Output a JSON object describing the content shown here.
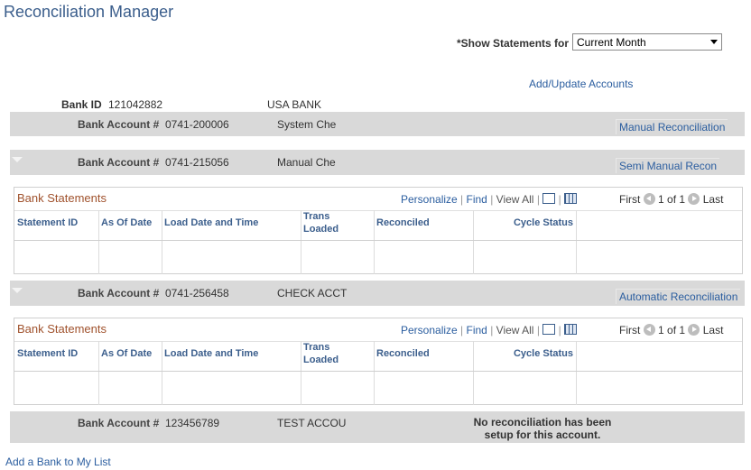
{
  "page": {
    "title": "Reconciliation Manager",
    "show_statements_label": "*Show Statements for",
    "show_statements_value": "Current Month",
    "add_update_accounts": "Add/Update Accounts",
    "add_bank_link": "Add a Bank to My List"
  },
  "bank": {
    "id_label": "Bank ID",
    "id_value": "121042882",
    "name": "USA BANK"
  },
  "accounts": [
    {
      "label": "Bank Account #",
      "number": "0741-200006",
      "desc": "System Che",
      "recon_link": "Manual Reconciliation"
    },
    {
      "label": "Bank Account #",
      "number": "0741-215056",
      "desc": "Manual Che",
      "recon_link": "Semi Manual Recon"
    },
    {
      "label": "Bank Account #",
      "number": "0741-256458",
      "desc": "CHECK ACCT",
      "recon_link": "Automatic Reconciliation"
    },
    {
      "label": "Bank Account #",
      "number": "123456789",
      "desc": "TEST ACCOU",
      "note": "No reconciliation has been setup for this account."
    }
  ],
  "grid": {
    "title": "Bank Statements",
    "personalize": "Personalize",
    "find": "Find",
    "view_all": "View All",
    "separator": "|",
    "first": "First",
    "range": "1 of 1",
    "last": "Last",
    "columns": {
      "statement_id": "Statement ID",
      "as_of_date": "As Of Date",
      "load_date_time": "Load Date and Time",
      "trans_loaded_1": "Trans",
      "trans_loaded_2": "Loaded",
      "reconciled": "Reconciled",
      "cycle_status": "Cycle Status"
    }
  },
  "icons": {
    "collapse": "collapse-triangle-icon",
    "zoom": "zoom-grid-icon",
    "download": "download-excel-icon",
    "prev": "previous-row-icon",
    "next": "next-row-icon"
  },
  "colors": {
    "link": "#2a5d9f",
    "title": "#3b5e8c",
    "grid_title": "#a0522d",
    "bar": "#d9d9d9"
  }
}
